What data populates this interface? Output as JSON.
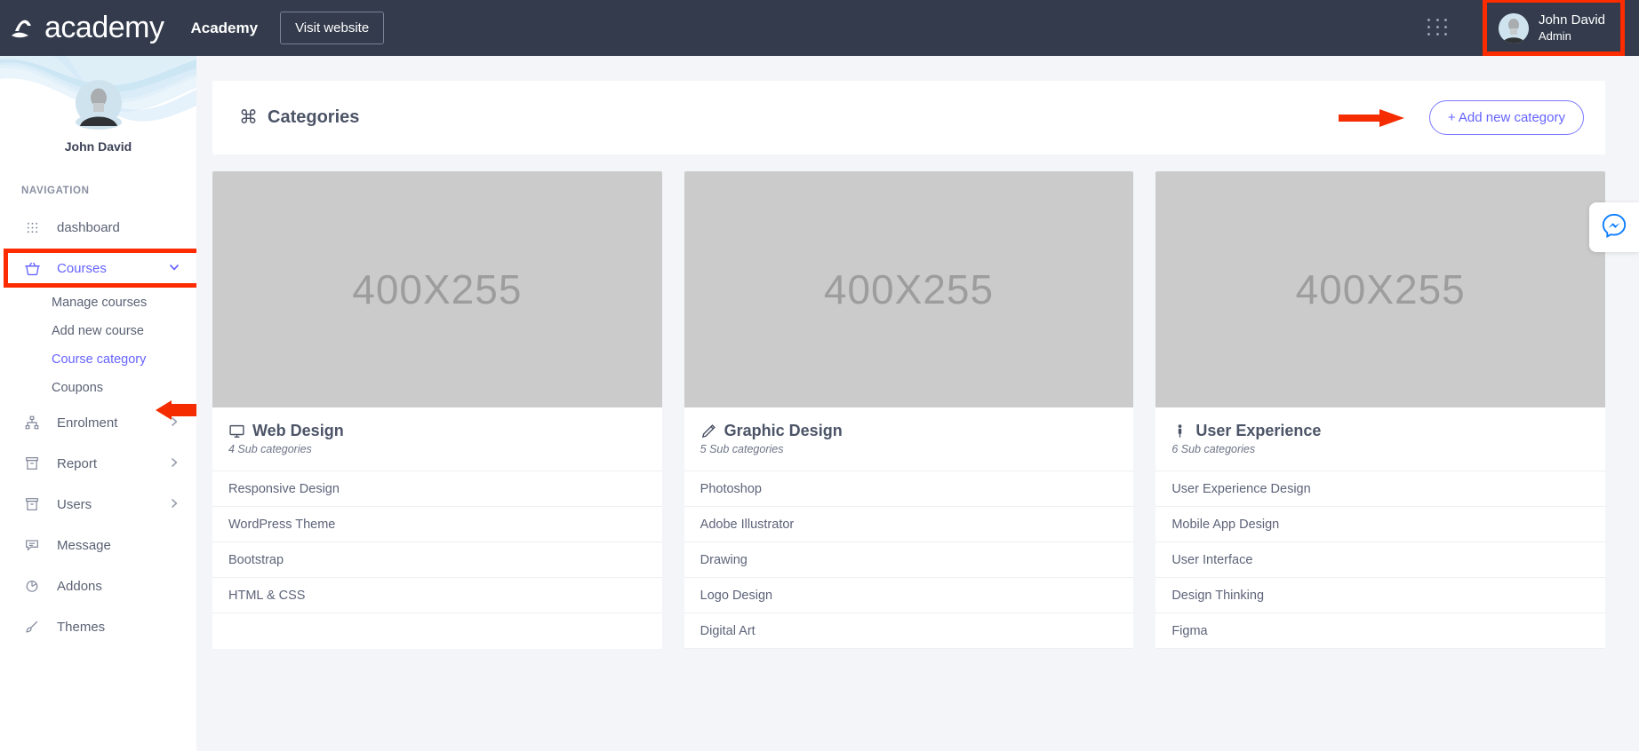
{
  "topbar": {
    "logo_icon": "academy-logo-icon",
    "logo_word": "academy",
    "brand_name": "Academy",
    "visit_label": "Visit website",
    "apps_icon": "grid-apps-icon",
    "user": {
      "name": "John David",
      "role": "Admin",
      "avatar_icon": "avatar-icon"
    }
  },
  "sidebar": {
    "profile_name": "John David",
    "nav_label": "NAVIGATION",
    "items": [
      {
        "label": "dashboard",
        "icon": "grid-dots-icon",
        "has_chevron": false,
        "active": false
      },
      {
        "label": "Courses",
        "icon": "basket-icon",
        "has_chevron": true,
        "chevron": "chevron-down-icon",
        "active": true,
        "highlighted": true
      },
      {
        "label": "Enrolment",
        "icon": "sitemap-icon",
        "has_chevron": true,
        "chevron": "chevron-right-icon",
        "active": false
      },
      {
        "label": "Report",
        "icon": "archive-icon",
        "has_chevron": true,
        "chevron": "chevron-right-icon",
        "active": false
      },
      {
        "label": "Users",
        "icon": "archive-icon",
        "has_chevron": true,
        "chevron": "chevron-right-icon",
        "active": false
      },
      {
        "label": "Message",
        "icon": "message-icon",
        "has_chevron": false,
        "active": false
      },
      {
        "label": "Addons",
        "icon": "pie-chart-icon",
        "has_chevron": false,
        "active": false
      },
      {
        "label": "Themes",
        "icon": "brush-icon",
        "has_chevron": false,
        "active": false
      }
    ],
    "sub_items": [
      {
        "label": "Manage courses",
        "active": false
      },
      {
        "label": "Add new course",
        "active": false
      },
      {
        "label": "Course category",
        "active": true
      },
      {
        "label": "Coupons",
        "active": false
      }
    ]
  },
  "page": {
    "title": "Categories",
    "title_icon": "command-icon",
    "add_button": "+ Add new category"
  },
  "annotations": {
    "box_color": "#fc2b00",
    "arrow_color": "#f42c00",
    "targets": [
      "user-profile-chip",
      "sidebar-courses-item",
      "course-category-link",
      "add-new-category-button"
    ]
  },
  "cards": [
    {
      "image_text": "400X255",
      "title": "Web Design",
      "icon": "monitor-icon",
      "sub_count": "4 Sub categories",
      "subcategories": [
        "Responsive Design",
        "WordPress Theme",
        "Bootstrap",
        "HTML & CSS"
      ]
    },
    {
      "image_text": "400X255",
      "title": "Graphic Design",
      "icon": "pencil-icon",
      "sub_count": "5 Sub categories",
      "subcategories": [
        "Photoshop",
        "Adobe Illustrator",
        "Drawing",
        "Logo Design",
        "Digital Art"
      ]
    },
    {
      "image_text": "400X255",
      "title": "User Experience",
      "icon": "person-icon",
      "sub_count": "6 Sub categories",
      "subcategories": [
        "User Experience Design",
        "Mobile App Design",
        "User Interface",
        "Design Thinking",
        "Figma"
      ]
    }
  ],
  "fab": {
    "icon": "messenger-icon",
    "color": "#0a7cff"
  }
}
